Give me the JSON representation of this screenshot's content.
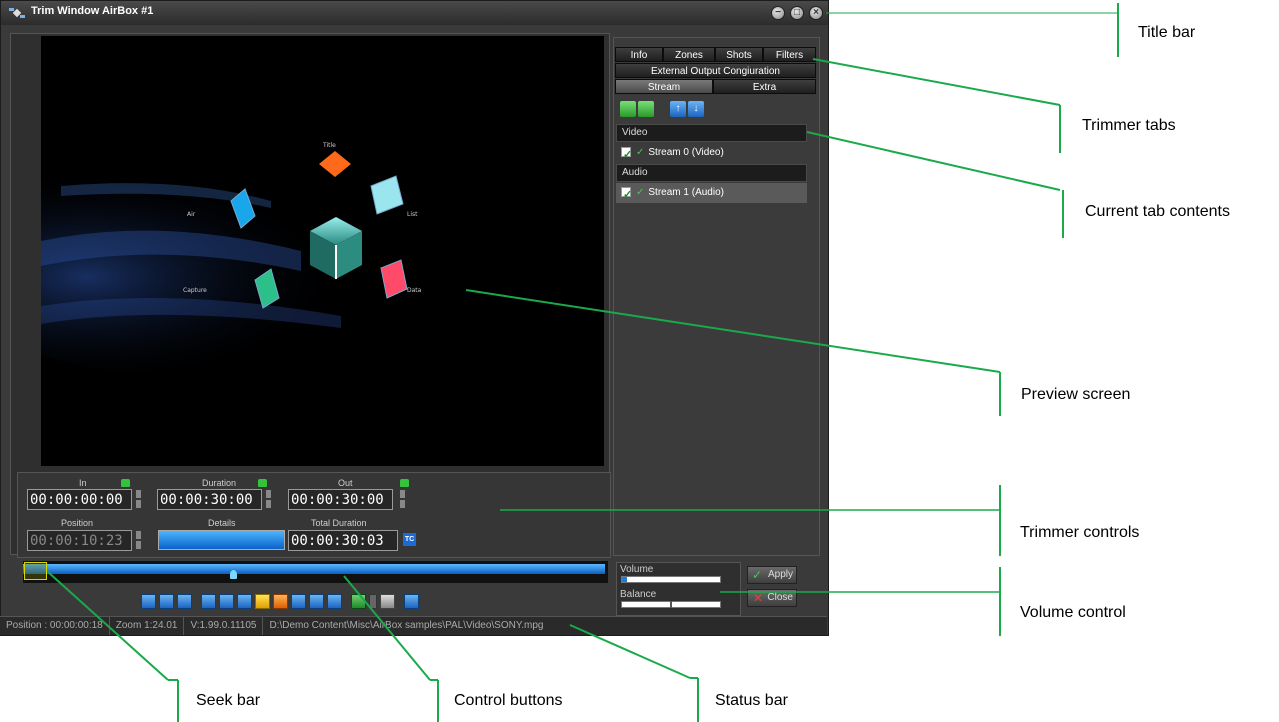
{
  "window": {
    "title": "Trim Window AirBox #1"
  },
  "preview": {
    "labels": {
      "top": "Title",
      "left": "Air",
      "right": "List",
      "bottom_left": "Capture",
      "bottom_right": "Data"
    }
  },
  "trimmer": {
    "in_label": "In",
    "in_value": "00:00:00:00",
    "duration_label": "Duration",
    "duration_value": "00:00:30:00",
    "out_label": "Out",
    "out_value": "00:00:30:00",
    "position_label": "Position",
    "position_value": "00:00:10:23",
    "details_label": "Details",
    "total_label": "Total Duration",
    "total_value": "00:00:30:03",
    "tc_label": "TC"
  },
  "seek": {
    "position_fraction": 0.36
  },
  "tabs": {
    "row1": [
      "Info",
      "Zones",
      "Shots",
      "Filters"
    ],
    "row2": "External Output Congiuration",
    "row3": [
      "Stream",
      "Extra"
    ],
    "active": "Stream"
  },
  "streams": {
    "groups": [
      {
        "name": "Video",
        "items": [
          "Stream 0 (Video)"
        ]
      },
      {
        "name": "Audio",
        "items": [
          "Stream 1 (Audio)"
        ]
      }
    ]
  },
  "volume": {
    "volume_label": "Volume",
    "balance_label": "Balance",
    "volume_level": 0.05,
    "balance_level": 0.5
  },
  "actions": {
    "apply": "Apply",
    "close": "Close"
  },
  "status": {
    "position": "Position : 00:00:00:18",
    "zoom": "Zoom 1:24.01",
    "version": "V:1.99.0.11105",
    "path": "D:\\Demo Content\\Misc\\AirBox samples\\PAL\\Video\\SONY.mpg"
  },
  "callouts": {
    "title_bar": "Title bar",
    "trimmer_tabs": "Trimmer tabs",
    "current_tab": "Current tab contents",
    "preview_screen": "Preview screen",
    "trimmer_controls": "Trimmer controls",
    "volume_control": "Volume control",
    "seek_bar": "Seek bar",
    "control_buttons": "Control buttons",
    "status_bar": "Status bar"
  },
  "colors": {
    "accent_green": "#1aaa4a",
    "timeline_blue": "#1a7fe0"
  }
}
